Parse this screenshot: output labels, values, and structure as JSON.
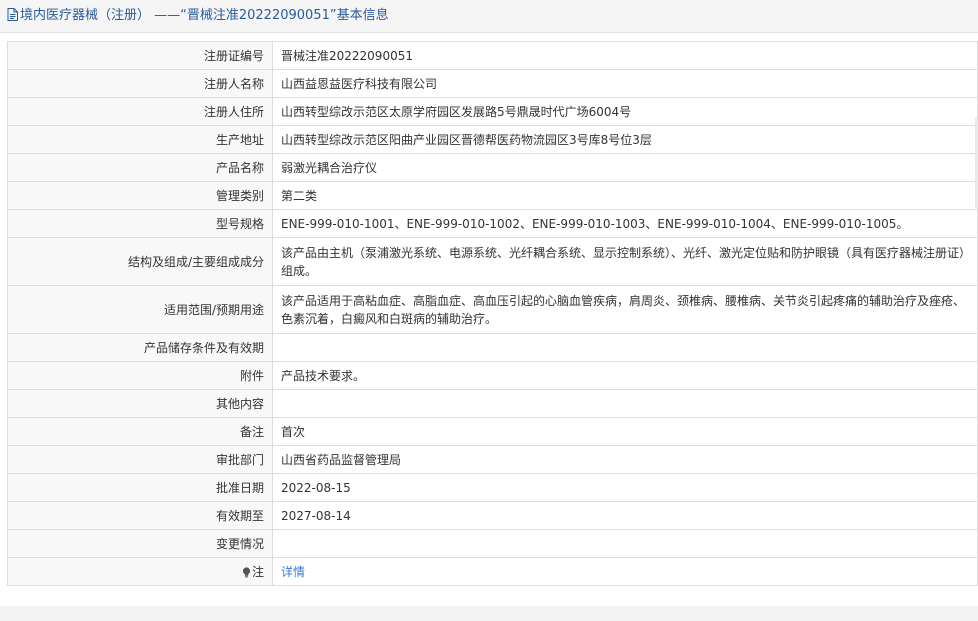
{
  "header": {
    "title": "境内医疗器械（注册） ——“晋械注准20222090051”基本信息"
  },
  "rows": [
    {
      "label": "注册证编号",
      "value": "晋械注准20222090051"
    },
    {
      "label": "注册人名称",
      "value": "山西益恩益医疗科技有限公司"
    },
    {
      "label": "注册人住所",
      "value": "山西转型综改示范区太原学府园区发展路5号鼎晟时代广场6004号"
    },
    {
      "label": "生产地址",
      "value": "山西转型综改示范区阳曲产业园区晋德帮医药物流园区3号库8号位3层"
    },
    {
      "label": "产品名称",
      "value": "弱激光耦合治疗仪"
    },
    {
      "label": "管理类别",
      "value": "第二类"
    },
    {
      "label": "型号规格",
      "value": "ENE-999-010-1001、ENE-999-010-1002、ENE-999-010-1003、ENE-999-010-1004、ENE-999-010-1005。"
    },
    {
      "label": "结构及组成/主要组成成分",
      "value": "该产品由主机（泵浦激光系统、电源系统、光纤耦合系统、显示控制系统）、光纤、激光定位贴和防护眼镜（具有医疗器械注册证）组成。"
    },
    {
      "label": "适用范围/预期用途",
      "value": "该产品适用于高粘血症、高脂血症、高血压引起的心脑血管疾病，肩周炎、颈椎病、腰椎病、关节炎引起疼痛的辅助治疗及痤疮、色素沉着，白癜风和白斑病的辅助治疗。"
    },
    {
      "label": "产品储存条件及有效期",
      "value": ""
    },
    {
      "label": "附件",
      "value": "产品技术要求。"
    },
    {
      "label": "其他内容",
      "value": ""
    },
    {
      "label": "备注",
      "value": "首次"
    },
    {
      "label": "审批部门",
      "value": "山西省药品监督管理局"
    },
    {
      "label": "批准日期",
      "value": "2022-08-15"
    },
    {
      "label": "有效期至",
      "value": "2027-08-14"
    },
    {
      "label": "变更情况",
      "value": ""
    }
  ],
  "note": {
    "label": "注",
    "link_text": "详情",
    "icon": "lightbulb-icon"
  },
  "colors": {
    "header_text": "#2a5a9a",
    "link": "#3a7bd5",
    "label_bg": "#f8f8f8",
    "border": "#dddddd"
  }
}
